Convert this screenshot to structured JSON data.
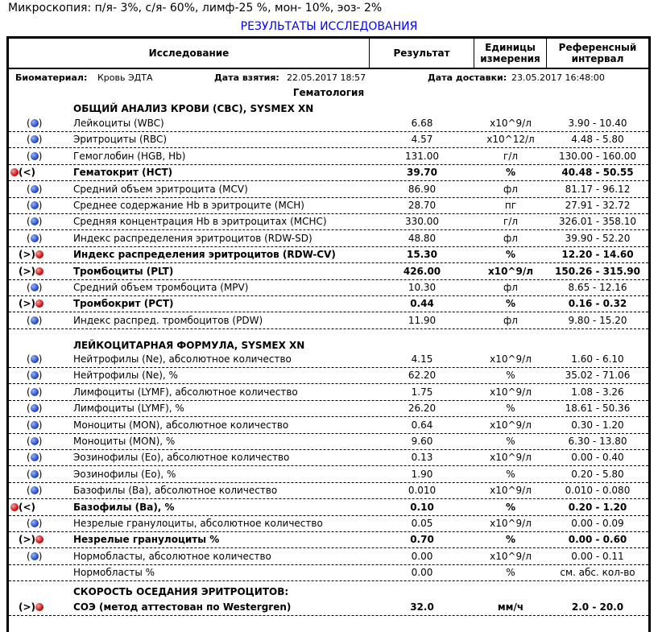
{
  "microscopy": "Микроскопия: п/я- 3%, с/я- 60%, лимф-25 %, мон- 10%, эоз- 2%",
  "title": "РЕЗУЛЬТАТЫ ИССЛЕДОВАНИЯ",
  "headers": {
    "test": "Исследование",
    "result": "Результат",
    "units": "Единицы измерения",
    "ref": "Референсный интервал"
  },
  "meta": {
    "bio_label": "Биоматериал:",
    "bio_value": "Кровь ЭДТА",
    "taken_label": "Дата взятия:",
    "taken_value": "22.05.2017 18:57",
    "delivered_label": "Дата доставки:",
    "delivered_value": "23.05.2017 16:48:00"
  },
  "section": "Гематология",
  "groups": {
    "cbc": "ОБЩИЙ АНАЛИЗ КРОВИ (CBC), SYSMEX XN",
    "wbc": "ЛЕЙКОЦИТАРНАЯ ФОРМУЛА, SYSMEX XN",
    "esr": "СКОРОСТЬ ОСЕДАНИЯ ЭРИТРОЦИТОВ:"
  },
  "rows": [
    {
      "flag": "()",
      "ball": "blue",
      "name": "Лейкоциты (WBC)",
      "result": "6.68",
      "unit": "x10^9/л",
      "ref": "3.90 - 10.40",
      "bold": false
    },
    {
      "flag": "()",
      "ball": "blue",
      "name": "Эритроциты (RBC)",
      "result": "4.57",
      "unit": "x10^12/л",
      "ref": "4.48 - 5.80",
      "bold": false
    },
    {
      "flag": "()",
      "ball": "blue",
      "name": "Гемоглобин (HGB, Hb)",
      "result": "131.00",
      "unit": "г/л",
      "ref": "130.00 - 160.00",
      "bold": false
    },
    {
      "flag": "(<)",
      "ball": "red",
      "name": "Гематокрит (HCT)",
      "result": "39.70",
      "unit": "%",
      "ref": "40.48 - 50.55",
      "bold": true
    },
    {
      "flag": "()",
      "ball": "blue",
      "name": "Средний объем эритроцита (MCV)",
      "result": "86.90",
      "unit": "фл",
      "ref": "81.17 - 96.12",
      "bold": false
    },
    {
      "flag": "()",
      "ball": "blue",
      "name": "Среднее содержание Hb в эритроците (MCH)",
      "result": "28.70",
      "unit": "пг",
      "ref": "27.91 - 32.72",
      "bold": false
    },
    {
      "flag": "()",
      "ball": "blue",
      "name": "Средняя концентрация Hb в эритроцитах (MCHC)",
      "result": "330.00",
      "unit": "г/л",
      "ref": "326.01 - 358.10",
      "bold": false
    },
    {
      "flag": "()",
      "ball": "blue",
      "name": "Индекс распределения эритроцитов (RDW-SD)",
      "result": "48.80",
      "unit": "фл",
      "ref": "39.90 - 52.20",
      "bold": false
    },
    {
      "flag": "(>)",
      "ball": "red",
      "name": "Индекс распределения эритроцитов (RDW-CV)",
      "result": "15.30",
      "unit": "%",
      "ref": "12.20 - 14.60",
      "bold": true
    },
    {
      "flag": "(>)",
      "ball": "red",
      "name": "Тромбоциты (PLT)",
      "result": "426.00",
      "unit": "x10^9/л",
      "ref": "150.26 - 315.90",
      "bold": true
    },
    {
      "flag": "()",
      "ball": "blue",
      "name": "Средний объем тромбоцита (MPV)",
      "result": "10.30",
      "unit": "фл",
      "ref": "8.65 - 12.16",
      "bold": false
    },
    {
      "flag": "(>)",
      "ball": "red",
      "name": "Тромбокрит (PCT)",
      "result": "0.44",
      "unit": "%",
      "ref": "0.16 - 0.32",
      "bold": true
    },
    {
      "flag": "()",
      "ball": "blue",
      "name": "Индекс распред. тромбоцитов (PDW)",
      "result": "11.90",
      "unit": "фл",
      "ref": "9.80 - 15.20",
      "bold": false
    },
    {
      "flag": "()",
      "ball": "blue",
      "name": "Нейтрофилы (Ne), абсолютное количество",
      "result": "4.15",
      "unit": "x10^9/л",
      "ref": "1.60 - 6.10",
      "bold": false
    },
    {
      "flag": "()",
      "ball": "blue",
      "name": "Нейтрофилы (Ne), %",
      "result": "62.20",
      "unit": "%",
      "ref": "35.02 - 71.06",
      "bold": false
    },
    {
      "flag": "()",
      "ball": "blue",
      "name": "Лимфоциты (LYMF), абсолютное количество",
      "result": "1.75",
      "unit": "x10^9/л",
      "ref": "1.08 - 3.26",
      "bold": false
    },
    {
      "flag": "()",
      "ball": "blue",
      "name": "Лимфоциты (LYMF), %",
      "result": "26.20",
      "unit": "%",
      "ref": "18.61 - 50.36",
      "bold": false
    },
    {
      "flag": "()",
      "ball": "blue",
      "name": "Моноциты (MON), абсолютное количество",
      "result": "0.64",
      "unit": "x10^9/л",
      "ref": "0.30 - 1.20",
      "bold": false
    },
    {
      "flag": "()",
      "ball": "blue",
      "name": "Моноциты (MON), %",
      "result": "9.60",
      "unit": "%",
      "ref": "6.30 - 13.80",
      "bold": false
    },
    {
      "flag": "()",
      "ball": "blue",
      "name": "Эозинофилы (Eo), абсолютное количество",
      "result": "0.13",
      "unit": "x10^9/л",
      "ref": "0.00 - 0.40",
      "bold": false
    },
    {
      "flag": "()",
      "ball": "blue",
      "name": "Эозинофилы (Eo), %",
      "result": "1.90",
      "unit": "%",
      "ref": "0.20 - 5.80",
      "bold": false
    },
    {
      "flag": "()",
      "ball": "blue",
      "name": "Базофилы (Ba), абсолютное количество",
      "result": "0.010",
      "unit": "x10^9/л",
      "ref": "0.010 - 0.080",
      "bold": false
    },
    {
      "flag": "(<)",
      "ball": "red",
      "name": "Базофилы (Ba), %",
      "result": "0.10",
      "unit": "%",
      "ref": "0.20 - 1.20",
      "bold": true
    },
    {
      "flag": "()",
      "ball": "blue",
      "name": "Незрелые гранулоциты, абсолютное количество",
      "result": "0.05",
      "unit": "x10^9/л",
      "ref": "0.00 - 0.09",
      "bold": false
    },
    {
      "flag": "(>)",
      "ball": "red",
      "name": "Незрелые гранулоциты %",
      "result": "0.70",
      "unit": "%",
      "ref": "0.00 - 0.60",
      "bold": true
    },
    {
      "flag": "()",
      "ball": "blue",
      "name": "Нормобласты, абсолютное количество",
      "result": "0.00",
      "unit": "x10^9/л",
      "ref": "0.00 - 0.11",
      "bold": false
    },
    {
      "flag": "",
      "ball": "",
      "name": "Нормобласты %",
      "result": "0.00",
      "unit": "%",
      "ref": "см. абс. кол-во",
      "bold": false
    },
    {
      "flag": "(>)",
      "ball": "red",
      "name": "СОЭ (метод аттестован по Westergren)",
      "result": "32.0",
      "unit": "мм/ч",
      "ref": "2.0 - 20.0",
      "bold": true
    }
  ]
}
